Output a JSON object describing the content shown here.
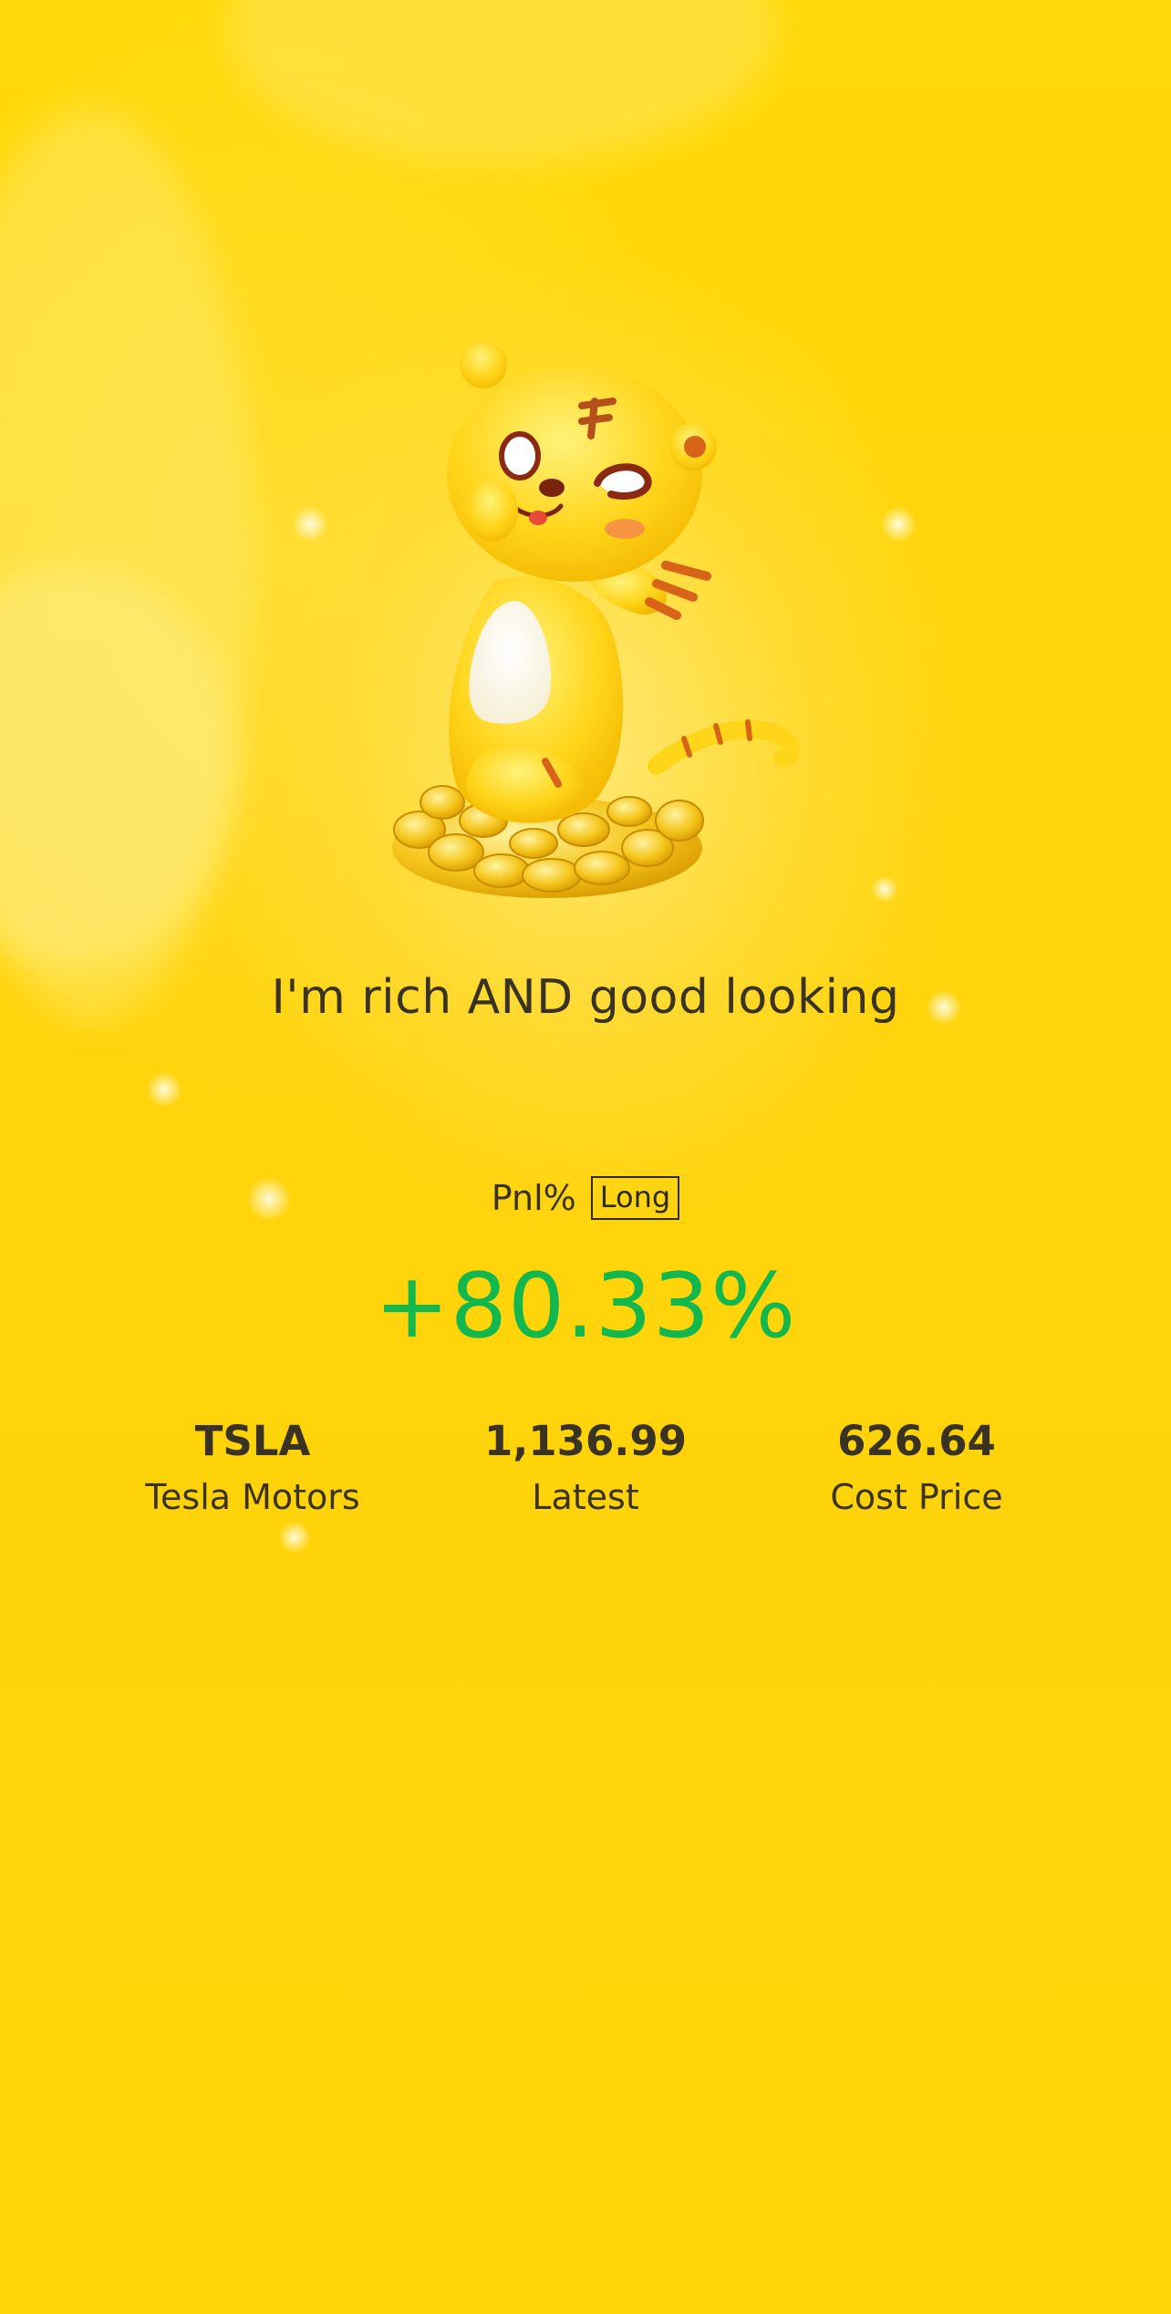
{
  "share_card": {
    "caption": "I'm rich AND good looking",
    "pnl_label": "Pnl%",
    "position_type": "Long",
    "pnl_value": "+80.33%",
    "stats": [
      {
        "value": "TSLA",
        "label": "Tesla Motors"
      },
      {
        "value": "1,136.99",
        "label": "Latest"
      },
      {
        "value": "626.64",
        "label": "Cost Price"
      }
    ],
    "mascot": "tiger-mascot-on-gold-coins"
  },
  "colors": {
    "background": "#ffd60a",
    "text": "#3a3323",
    "gain": "#12b84e"
  }
}
